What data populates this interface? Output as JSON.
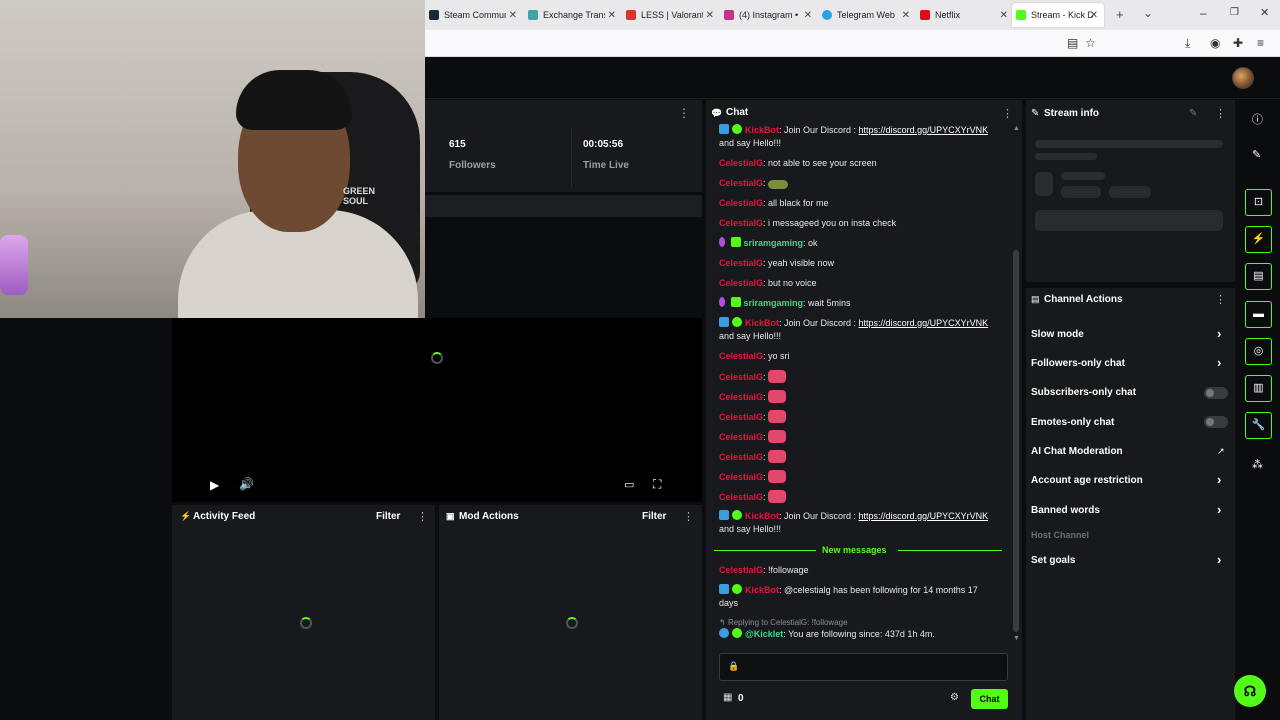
{
  "browser": {
    "tabs": [
      {
        "title": "Steam Communi",
        "color": "#1b2838"
      },
      {
        "title": "Exchange Transa",
        "color": "#3aa7a0"
      },
      {
        "title": "LESS | Valorant G",
        "color": "#e0312d"
      },
      {
        "title": "(4) Instagram • M",
        "color": "#c13584"
      },
      {
        "title": "Telegram Web",
        "color": "#2aa3e0"
      },
      {
        "title": "Netflix",
        "color": "#e50914"
      },
      {
        "title": "Stream - Kick Da",
        "color": "#53fc18"
      }
    ],
    "new_tab_icon": "+",
    "tab_list_icon": "⌄",
    "close_icon": "✕",
    "nav_icons": [
      "reader-icon",
      "bookmark-icon",
      "download-icon",
      "account-icon",
      "extensions-icon",
      "menu-icon"
    ]
  },
  "brand_on_chair": "GREEN\nSOUL",
  "stats": {
    "followers_value": "615",
    "followers_label": "Followers",
    "time_value": "00:05:56",
    "time_label": "Time Live"
  },
  "activity_feed": {
    "title": "Activity Feed",
    "filter": "Filter"
  },
  "mod_actions": {
    "title": "Mod Actions",
    "filter": "Filter"
  },
  "chat": {
    "title": "Chat",
    "messages": [
      {
        "user": "KickBot",
        "text": ": Join Our Discord : ",
        "link": "https://discord.gg/UPYCXYrVNK",
        "text2": "and say Hello!!!"
      },
      {
        "user": "CelestialG",
        "text": ": not able to see your screen"
      },
      {
        "user": "CelestialG",
        "text": ":"
      },
      {
        "user": "CelestialG",
        "text": ": all black for me"
      },
      {
        "user": "CelestialG",
        "text": ": i messageed you on insta check"
      },
      {
        "user": "sriramgaming",
        "text": ": ok"
      },
      {
        "user": "CelestialG",
        "text": ": yeah visible now"
      },
      {
        "user": "CelestialG",
        "text": ": but no voice"
      },
      {
        "user": "sriramgaming",
        "text": ": wait 5mins"
      },
      {
        "user": "KickBot",
        "text": ": Join Our Discord : ",
        "link": "https://discord.gg/UPYCXYrVNK",
        "text2": "and say Hello!!!"
      },
      {
        "user": "CelestialG",
        "text": ": yo sri"
      },
      {
        "user": "CelestialG",
        "text": ":"
      },
      {
        "user": "CelestialG",
        "text": ":"
      },
      {
        "user": "CelestialG",
        "text": ":"
      },
      {
        "user": "CelestialG",
        "text": ":"
      },
      {
        "user": "CelestialG",
        "text": ":"
      },
      {
        "user": "CelestialG",
        "text": ":"
      },
      {
        "user": "CelestialG",
        "text": ":"
      },
      {
        "user": "KickBot",
        "text": ": Join Our Discord : ",
        "link": "https://discord.gg/UPYCXYrVNK",
        "text2": "and say Hello!!!"
      },
      {
        "user": "CelestialG",
        "text": ": !followage"
      },
      {
        "user": "KickBot",
        "text": ": @celestialg has been following for 14 months 17",
        "text2": "days"
      },
      {
        "user": "@Kicklet",
        "text": ": You are following since: 437d 1h 4m."
      }
    ],
    "new_messages": "New messages",
    "reply_text": "Replying to CelestialG: !followage",
    "input_placeholder": "",
    "count": "0",
    "send_label": "Chat"
  },
  "stream_info": {
    "title": "Stream info"
  },
  "channel_actions": {
    "title": "Channel Actions",
    "rows": [
      {
        "label": "Slow mode"
      },
      {
        "label": "Followers-only chat"
      },
      {
        "label": "Subscribers-only chat"
      },
      {
        "label": "Emotes-only chat"
      },
      {
        "label": "AI Chat Moderation"
      },
      {
        "label": "Account age restriction"
      },
      {
        "label": "Banned words"
      },
      {
        "label": "Host Channel"
      },
      {
        "label": "Set goals"
      }
    ]
  },
  "colors": {
    "accent": "#53fc18",
    "username_red": "#e9113c",
    "username_green": "#3fd58a"
  }
}
